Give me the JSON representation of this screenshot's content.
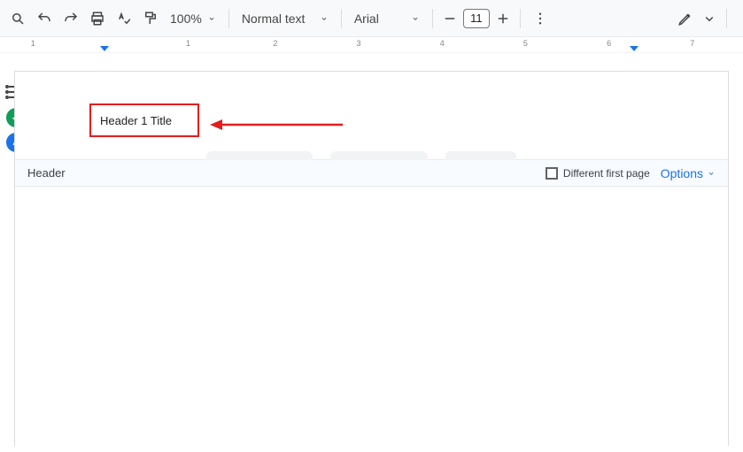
{
  "toolbar": {
    "zoom": "100%",
    "paragraph_style": "Normal text",
    "font_family": "Arial",
    "font_size": "11"
  },
  "ruler": {
    "numbers": [
      "1",
      "1",
      "2",
      "3",
      "4",
      "5",
      "6",
      "7"
    ]
  },
  "document": {
    "header_title": "Header 1 Title",
    "strip_label": "Header",
    "different_first_page": "Different first page",
    "options": "Options"
  },
  "sidebar": {
    "check_color": "#0f9d58",
    "feather_color": "#1a73e8"
  }
}
